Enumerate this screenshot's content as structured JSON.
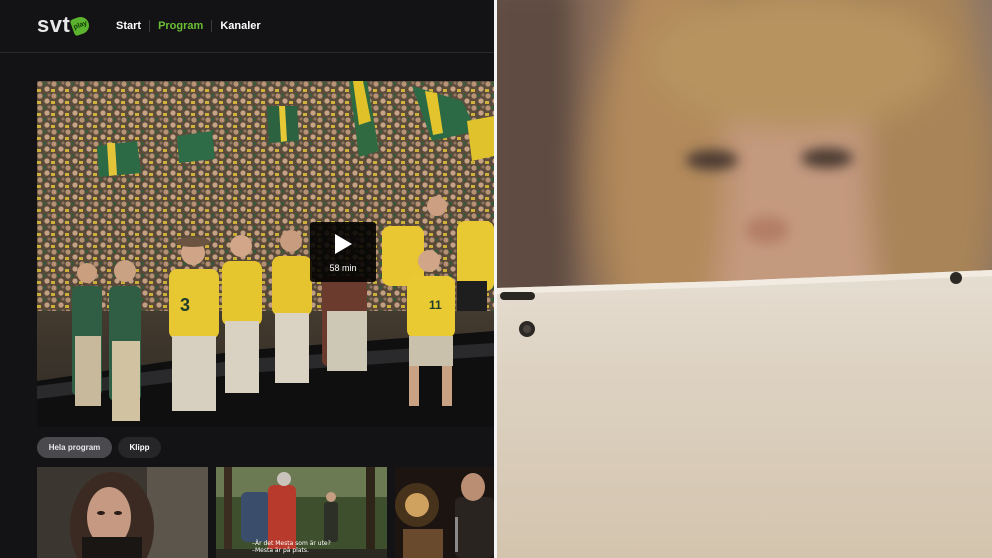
{
  "nav": {
    "logo_text": "svt",
    "logo_badge": "play",
    "links": [
      {
        "label": "Start",
        "active": false
      },
      {
        "label": "Program",
        "active": true
      },
      {
        "label": "Kanaler",
        "active": false
      }
    ]
  },
  "player": {
    "duration": "58 min"
  },
  "filters": {
    "full_programs": "Hela program",
    "clips": "Klipp"
  },
  "thumbnails": {
    "second_subtitle_line1": "–Är det Mesta som är ute?",
    "second_subtitle_line2": "–Mesta är på plats."
  },
  "colors": {
    "accent": "#6bbf35",
    "background": "#131315",
    "pill": "#3a3a3d"
  }
}
